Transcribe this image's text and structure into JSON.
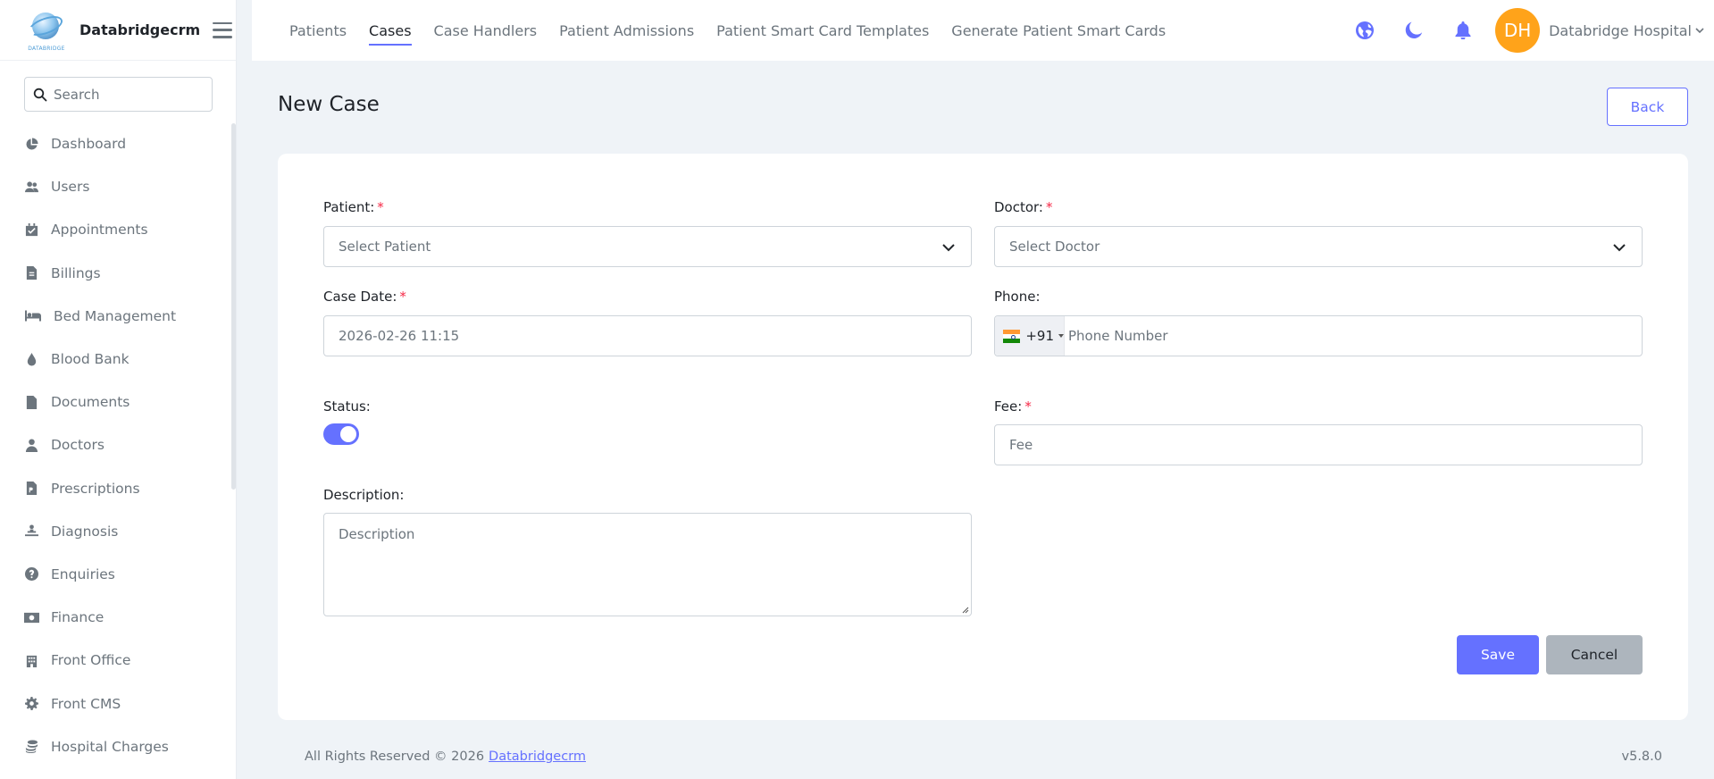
{
  "brand": {
    "name": "Databridgecrm",
    "logo_tag": "DATABRIDGE"
  },
  "search": {
    "placeholder": "Search"
  },
  "sidebar": {
    "items": [
      {
        "label": "Dashboard",
        "icon": "pie-chart-icon"
      },
      {
        "label": "Users",
        "icon": "users-icon"
      },
      {
        "label": "Appointments",
        "icon": "calendar-check-icon"
      },
      {
        "label": "Billings",
        "icon": "invoice-icon"
      },
      {
        "label": "Bed Management",
        "icon": "bed-icon"
      },
      {
        "label": "Blood Bank",
        "icon": "blood-drop-icon"
      },
      {
        "label": "Documents",
        "icon": "file-icon"
      },
      {
        "label": "Doctors",
        "icon": "doctor-icon"
      },
      {
        "label": "Prescriptions",
        "icon": "prescription-icon"
      },
      {
        "label": "Diagnosis",
        "icon": "diagnosis-icon"
      },
      {
        "label": "Enquiries",
        "icon": "question-circle-icon"
      },
      {
        "label": "Finance",
        "icon": "money-icon"
      },
      {
        "label": "Front Office",
        "icon": "building-icon"
      },
      {
        "label": "Front CMS",
        "icon": "gear-icon"
      },
      {
        "label": "Hospital Charges",
        "icon": "coins-icon"
      }
    ]
  },
  "topnav": {
    "items": [
      {
        "label": "Patients"
      },
      {
        "label": "Cases",
        "active": true
      },
      {
        "label": "Case Handlers"
      },
      {
        "label": "Patient Admissions"
      },
      {
        "label": "Patient Smart Card Templates"
      },
      {
        "label": "Generate Patient Smart Cards"
      }
    ]
  },
  "user": {
    "initials": "DH",
    "name": "Databridge Hospital"
  },
  "colors": {
    "accent": "#6571ff",
    "avatar": "#ffa31a",
    "required": "#f62947"
  },
  "page": {
    "title": "New Case",
    "back_label": "Back"
  },
  "form": {
    "patient": {
      "label": "Patient:",
      "placeholder": "Select Patient"
    },
    "doctor": {
      "label": "Doctor:",
      "placeholder": "Select Doctor"
    },
    "case_date": {
      "label": "Case Date:",
      "value": "2026-02-26 11:15"
    },
    "phone": {
      "label": "Phone:",
      "dial_code": "+91",
      "placeholder": "Phone Number"
    },
    "status": {
      "label": "Status:",
      "checked": true
    },
    "fee": {
      "label": "Fee:",
      "placeholder": "Fee"
    },
    "description": {
      "label": "Description:",
      "placeholder": "Description"
    },
    "required_mark": "*",
    "save_label": "Save",
    "cancel_label": "Cancel"
  },
  "footer": {
    "text": "All Rights Reserved © 2026",
    "link": "Databridgecrm",
    "version": "v5.8.0"
  }
}
